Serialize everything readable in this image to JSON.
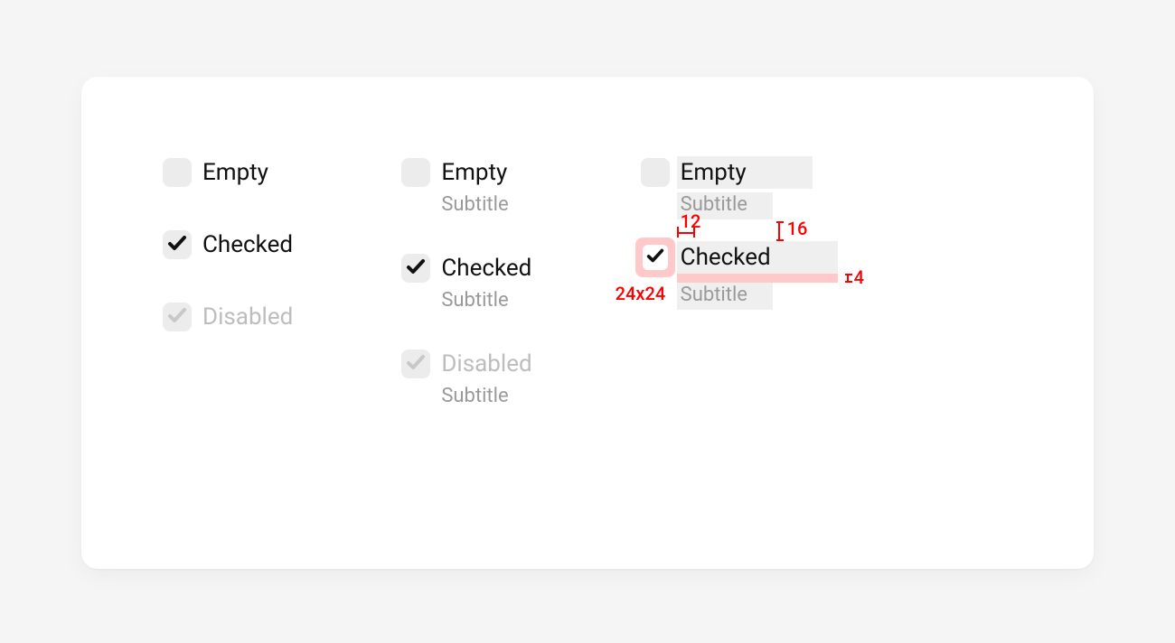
{
  "columns": {
    "simple": {
      "empty": {
        "title": "Empty"
      },
      "checked": {
        "title": "Checked"
      },
      "disabled": {
        "title": "Disabled"
      }
    },
    "withSubtitle": {
      "empty": {
        "title": "Empty",
        "subtitle": "Subtitle"
      },
      "checked": {
        "title": "Checked",
        "subtitle": "Subtitle"
      },
      "disabled": {
        "title": "Disabled",
        "subtitle": "Subtitle"
      }
    },
    "annotated": {
      "empty": {
        "title": "Empty",
        "subtitle": "Subtitle"
      },
      "checked": {
        "title": "Checked",
        "subtitle": "Subtitle"
      }
    }
  },
  "spec": {
    "boxSize": "24x24",
    "gapBoxToLabel": "12",
    "gapVertical": "16",
    "gapTitleToSubtitle": "4"
  }
}
